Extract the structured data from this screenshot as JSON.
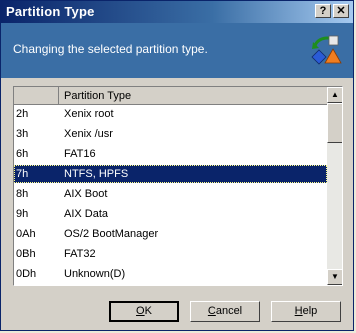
{
  "window": {
    "title": "Partition Type",
    "help_button": "?",
    "close_button": "✕"
  },
  "header": {
    "subtitle": "Changing the selected partition type.",
    "icon": "partition-type-icon"
  },
  "list": {
    "column_header": "Partition Type",
    "rows": [
      {
        "code": "2h",
        "name": "Xenix root"
      },
      {
        "code": "3h",
        "name": "Xenix /usr"
      },
      {
        "code": "6h",
        "name": "FAT16"
      },
      {
        "code": "7h",
        "name": "NTFS, HPFS",
        "selected": true
      },
      {
        "code": "8h",
        "name": "AIX Boot"
      },
      {
        "code": "9h",
        "name": "AIX Data"
      },
      {
        "code": "0Ah",
        "name": "OS/2 BootManager"
      },
      {
        "code": "0Bh",
        "name": "FAT32"
      },
      {
        "code": "0Dh",
        "name": "Unknown(D)"
      }
    ]
  },
  "buttons": {
    "ok": {
      "prefix": "",
      "accel": "O",
      "suffix": "K"
    },
    "cancel": {
      "prefix": "",
      "accel": "C",
      "suffix": "ancel"
    },
    "help": {
      "prefix": "",
      "accel": "H",
      "suffix": "elp"
    }
  },
  "colors": {
    "title_bar": "#0a246a",
    "header_bg": "#3a6ea5",
    "selection": "#0a246a",
    "dialog_bg": "#d4d0c8"
  }
}
